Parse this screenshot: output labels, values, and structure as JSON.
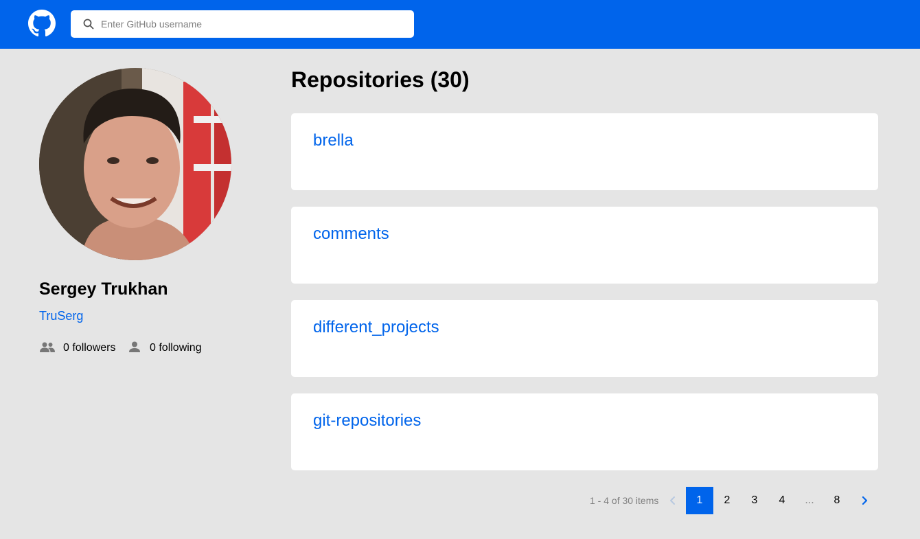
{
  "header": {
    "logo_icon": "github-icon",
    "search": {
      "placeholder": "Enter GitHub username",
      "value": "",
      "icon": "search-icon"
    }
  },
  "profile": {
    "name": "Sergey Trukhan",
    "login": "TruSerg",
    "followers_label": "0 followers",
    "following_label": "0 following",
    "followers_icon": "people-icon",
    "following_icon": "person-icon"
  },
  "repositories": {
    "title": "Repositories (30)",
    "items": [
      {
        "name": "brella"
      },
      {
        "name": "comments"
      },
      {
        "name": "different_projects"
      },
      {
        "name": "git-repositories"
      }
    ]
  },
  "pagination": {
    "summary": "1 - 4 of 30 items",
    "pages": [
      "1",
      "2",
      "3",
      "4",
      "...",
      "8"
    ],
    "active": "1",
    "prev_icon": "chevron-left-icon",
    "next_icon": "chevron-right-icon"
  },
  "colors": {
    "accent": "#0064eb",
    "background": "#e5e5e5",
    "card": "#ffffff"
  }
}
